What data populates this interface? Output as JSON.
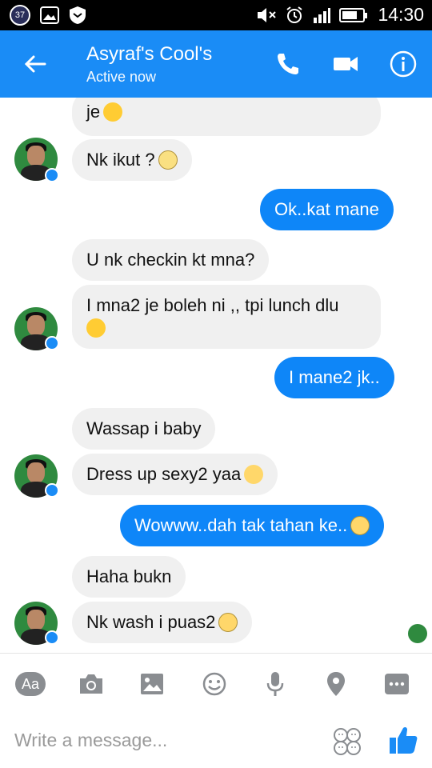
{
  "status_bar": {
    "badge": "37",
    "time": "14:30",
    "battery_level": 0.75
  },
  "header": {
    "title": "Asyraf's Cool's",
    "subtitle": "Active now",
    "icons": [
      "back-arrow-icon",
      "phone-icon",
      "video-camera-icon",
      "info-icon"
    ]
  },
  "messages": [
    {
      "side": "in",
      "text": "je",
      "emoji": "happy"
    },
    {
      "side": "in",
      "text": "Nk ikut ?",
      "emoji": "smile"
    },
    {
      "side": "out",
      "text": "Ok..kat mane"
    },
    {
      "side": "in",
      "text": "U nk checkin kt mna?"
    },
    {
      "side": "in",
      "text": "I mna2 je boleh ni ,, tpi lunch dlu",
      "emoji": "happy"
    },
    {
      "side": "out",
      "text": "I mane2 jk.."
    },
    {
      "side": "in",
      "text": "Wassap i baby"
    },
    {
      "side": "in",
      "text": "Dress up sexy2 yaa",
      "emoji": "heart-eyes"
    },
    {
      "side": "out",
      "text": "Wowww..dah tak tahan ke..",
      "emoji": "grin"
    },
    {
      "side": "in",
      "text": "Haha bukn"
    },
    {
      "side": "in",
      "text": "Nk wash i puas2",
      "emoji": "smirk"
    }
  ],
  "composer": {
    "aa_label": "Aa",
    "placeholder": "Write a message...",
    "tools": [
      "camera-icon",
      "gallery-icon",
      "emoji-icon",
      "microphone-icon",
      "location-icon",
      "more-icon"
    ]
  },
  "colors": {
    "brand_blue": "#1a8cf6",
    "outgoing_bubble": "#0e86f8",
    "incoming_bubble": "#f0f0f0"
  }
}
